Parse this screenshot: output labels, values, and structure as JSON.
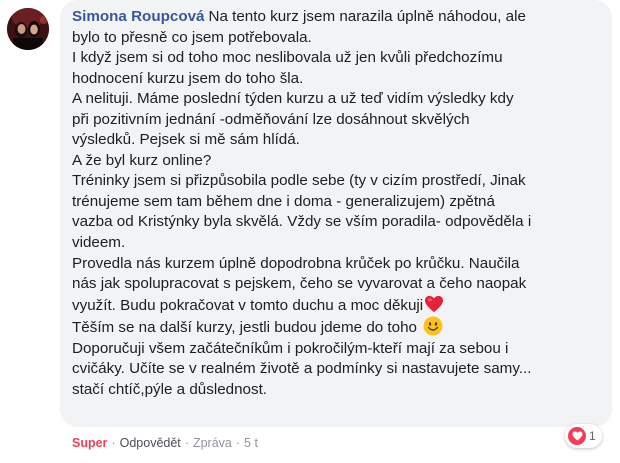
{
  "comment": {
    "author": "Simona Roupcová",
    "lines": [
      "Na tento kurz jsem narazila úplně náhodou, ale",
      "bylo to přesně co jsem potřebovala.",
      "I když jsem si od toho moc neslibovala už jen kvůli předchozímu",
      "hodnocení kurzu jsem do toho šla.",
      "A nelituji. Máme poslední týden kurzu a už teď vidím výsledky kdy",
      "při pozitivním jednání -odměňování lze dosáhnout skvělých",
      "výsledků. Pejsek si mě sám hlídá.",
      "A že byl kurz online?",
      "Tréninky jsem si přizpůsobila podle sebe (ty v cizím prostředí, Jinak",
      "trénujeme sem tam během dne i doma - generalizujem) zpětná",
      "vazba od Kristýnky byla skvělá. Vždy se vším poradila- odpověděla i",
      "videem.",
      "Provedla nás kurzem úplně dopodrobna krůček po krůčku. Naučila",
      "nás jak spolupracovat s pejskem, čeho se vyvarovat a čeho naopak",
      "využít. Budu pokračovat v tomto duchu a moc děkuji",
      "Těším se na další kurzy, jestli budou jdeme do toho",
      "Doporučuji všem začátečníkům i pokročilým-kteří mají za sebou i",
      "cvičáky. Učíte se v realném životě a podmínky si nastavujete samy...",
      "stačí chtíč,pýle a důslednost."
    ]
  },
  "actions": {
    "like": "Super",
    "reply": "Odpovědět",
    "message": "Zpráva",
    "time": "5 t",
    "separator": "·"
  },
  "reactions": {
    "icon": "heart-icon",
    "count": "1",
    "color": "#f33e58"
  },
  "colors": {
    "author": "#385898",
    "bubble": "#f2f3f5",
    "text": "#1c1e21",
    "like_active": "#f33e58"
  }
}
